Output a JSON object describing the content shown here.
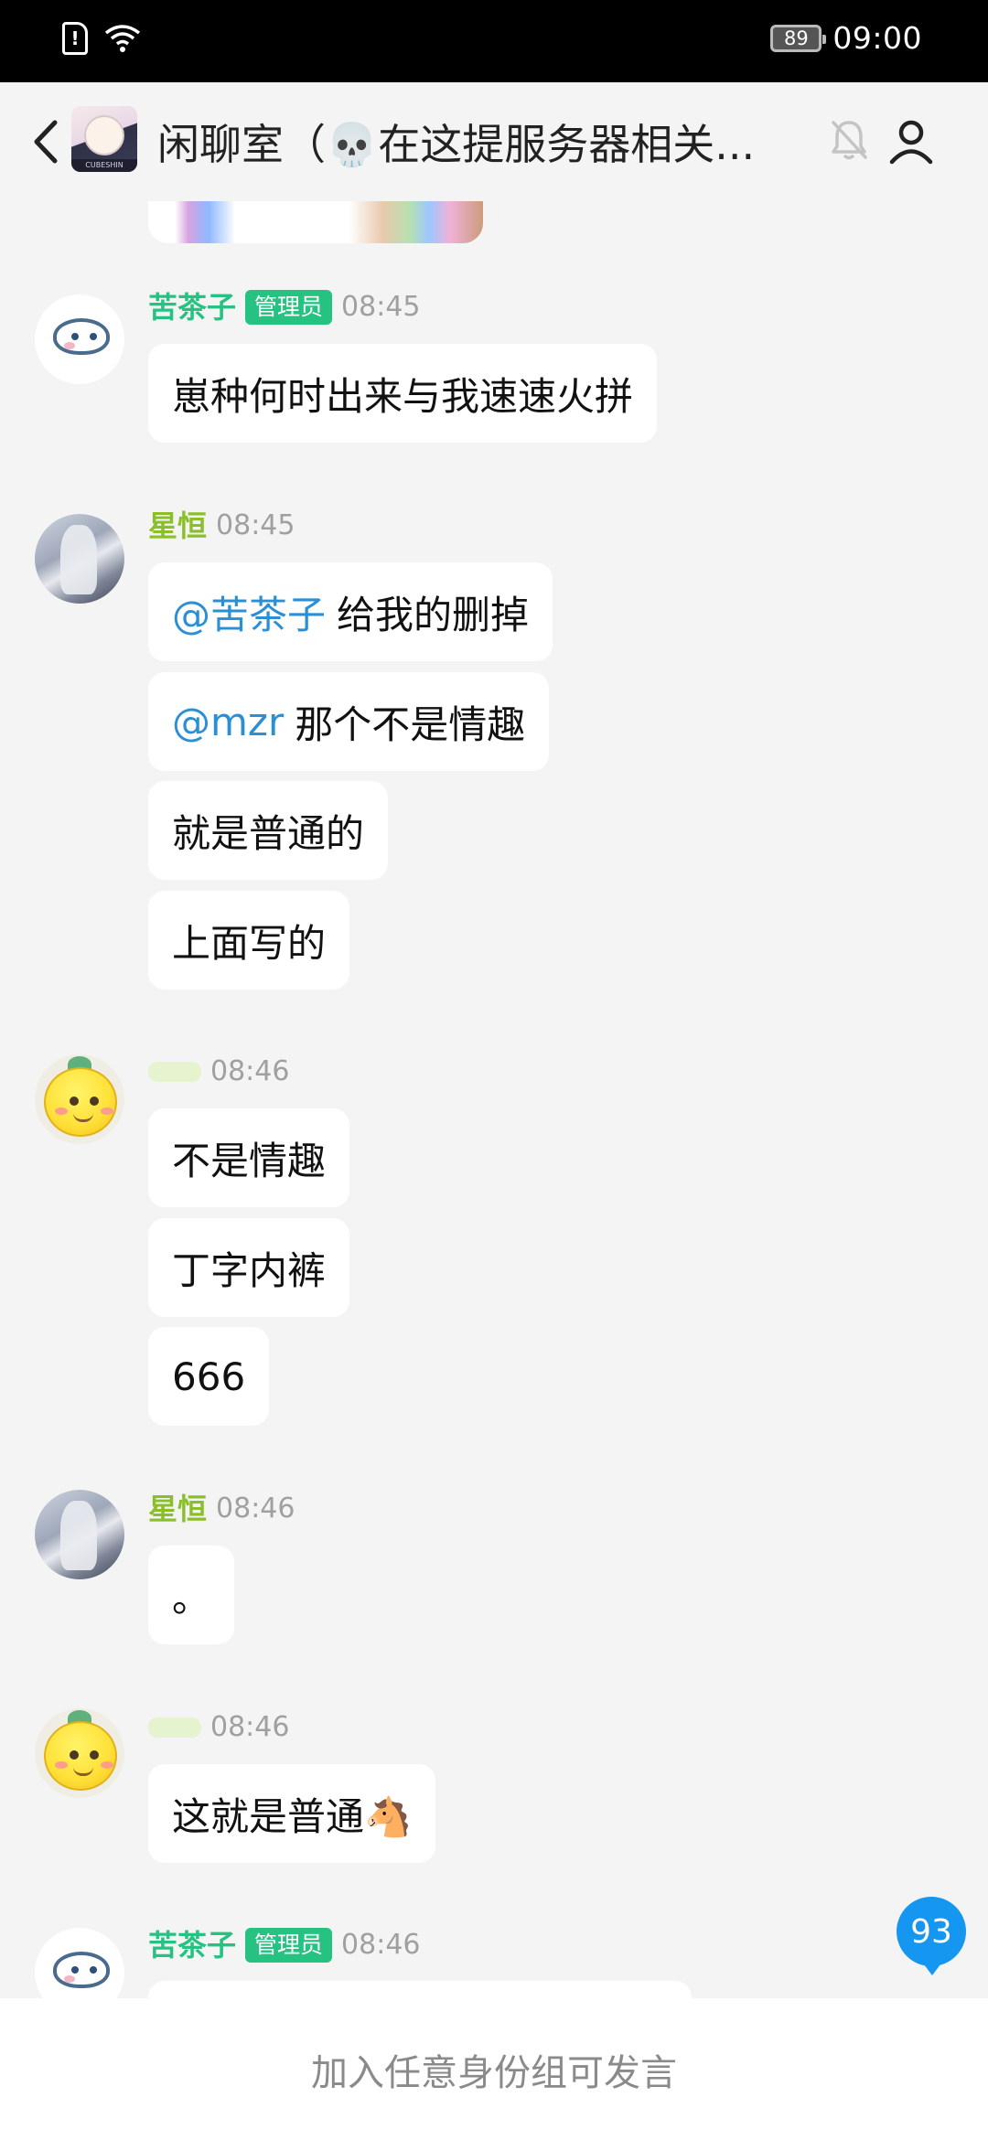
{
  "status_bar": {
    "battery": "89",
    "time": "09:00",
    "icons": [
      "sim-alert-icon",
      "wifi-icon",
      "battery-icon"
    ]
  },
  "header": {
    "title": "闲聊室（💀在这提服务器相关...",
    "avatar_tag": "CUBESHIN",
    "icons": [
      "back-icon",
      "bell-off-icon",
      "user-icon"
    ]
  },
  "messages": [
    {
      "sender": "苦茶子",
      "role": "管理员",
      "time": "08:45",
      "texts": [
        "崽种何时出来与我速速火拼"
      ]
    },
    {
      "sender": "星恒",
      "time": "08:45",
      "texts": [
        {
          "mention": "@苦茶子",
          "text": "给我的删掉"
        },
        {
          "mention": "@mzr",
          "text": "那个不是情趣"
        },
        "就是普通的",
        "上面写的"
      ]
    },
    {
      "sender": "",
      "time": "08:46",
      "texts": [
        "不是情趣",
        "丁字内裤",
        "666"
      ]
    },
    {
      "sender": "星恒",
      "time": "08:46",
      "texts": [
        "。"
      ]
    },
    {
      "sender": "",
      "time": "08:46",
      "texts": [
        "这就是普通🐴"
      ]
    },
    {
      "sender": "苦茶子",
      "role": "管理员",
      "time": "08:46",
      "texts": []
    }
  ],
  "unread_count": "93",
  "input_notice": "加入任意身份组可发言"
}
